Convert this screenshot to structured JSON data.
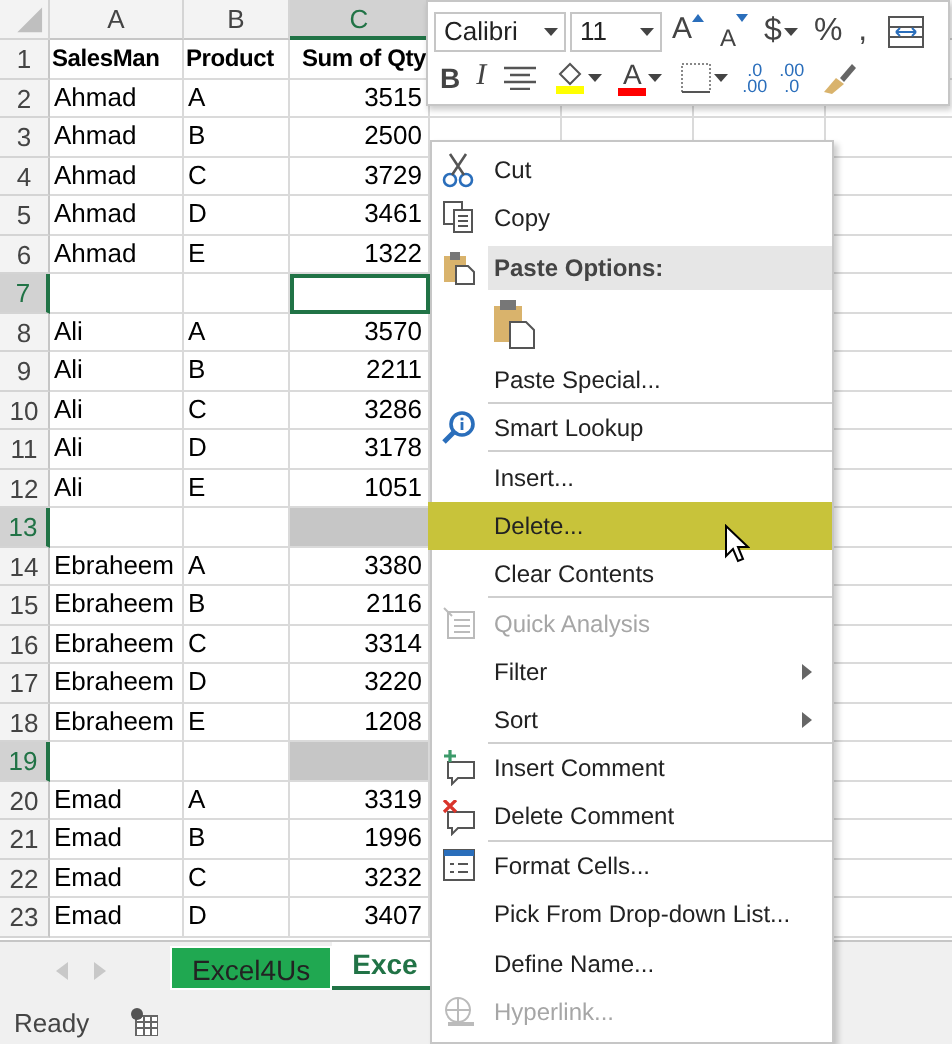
{
  "sheet": {
    "columns": [
      {
        "label": "A",
        "selected": false
      },
      {
        "label": "B",
        "selected": false
      },
      {
        "label": "C",
        "selected": true
      }
    ],
    "rows": [
      {
        "number": "1",
        "cells": [
          "SalesMan",
          "Product",
          "Sum of Qty"
        ],
        "bold": true,
        "selected": false,
        "active_cell": false
      },
      {
        "number": "2",
        "cells": [
          "Ahmad",
          "A",
          "3515"
        ],
        "bold": false,
        "selected": false,
        "active_cell": false
      },
      {
        "number": "3",
        "cells": [
          "Ahmad",
          "B",
          "2500"
        ],
        "bold": false,
        "selected": false,
        "active_cell": false
      },
      {
        "number": "4",
        "cells": [
          "Ahmad",
          "C",
          "3729"
        ],
        "bold": false,
        "selected": false,
        "active_cell": false
      },
      {
        "number": "5",
        "cells": [
          "Ahmad",
          "D",
          "3461"
        ],
        "bold": false,
        "selected": false,
        "active_cell": false
      },
      {
        "number": "6",
        "cells": [
          "Ahmad",
          "E",
          "1322"
        ],
        "bold": false,
        "selected": false,
        "active_cell": false
      },
      {
        "number": "7",
        "cells": [],
        "bold": false,
        "selected": true,
        "active_cell": true
      },
      {
        "number": "8",
        "cells": [
          "Ali",
          "A",
          "3570"
        ],
        "bold": false,
        "selected": false,
        "active_cell": false
      },
      {
        "number": "9",
        "cells": [
          "Ali",
          "B",
          "2211"
        ],
        "bold": false,
        "selected": false,
        "active_cell": false
      },
      {
        "number": "10",
        "cells": [
          "Ali",
          "C",
          "3286"
        ],
        "bold": false,
        "selected": false,
        "active_cell": false
      },
      {
        "number": "11",
        "cells": [
          "Ali",
          "D",
          "3178"
        ],
        "bold": false,
        "selected": false,
        "active_cell": false
      },
      {
        "number": "12",
        "cells": [
          "Ali",
          "E",
          "1051"
        ],
        "bold": false,
        "selected": false,
        "active_cell": false
      },
      {
        "number": "13",
        "cells": [],
        "bold": false,
        "selected": true,
        "active_cell": false
      },
      {
        "number": "14",
        "cells": [
          "Ebraheem",
          "A",
          "3380"
        ],
        "bold": false,
        "selected": false,
        "active_cell": false
      },
      {
        "number": "15",
        "cells": [
          "Ebraheem",
          "B",
          "2116"
        ],
        "bold": false,
        "selected": false,
        "active_cell": false
      },
      {
        "number": "16",
        "cells": [
          "Ebraheem",
          "C",
          "3314"
        ],
        "bold": false,
        "selected": false,
        "active_cell": false
      },
      {
        "number": "17",
        "cells": [
          "Ebraheem",
          "D",
          "3220"
        ],
        "bold": false,
        "selected": false,
        "active_cell": false
      },
      {
        "number": "18",
        "cells": [
          "Ebraheem",
          "E",
          "1208"
        ],
        "bold": false,
        "selected": false,
        "active_cell": false
      },
      {
        "number": "19",
        "cells": [],
        "bold": false,
        "selected": true,
        "active_cell": false
      },
      {
        "number": "20",
        "cells": [
          "Emad",
          "A",
          "3319"
        ],
        "bold": false,
        "selected": false,
        "active_cell": false
      },
      {
        "number": "21",
        "cells": [
          "Emad",
          "B",
          "1996"
        ],
        "bold": false,
        "selected": false,
        "active_cell": false
      },
      {
        "number": "22",
        "cells": [
          "Emad",
          "C",
          "3232"
        ],
        "bold": false,
        "selected": false,
        "active_cell": false
      },
      {
        "number": "23",
        "cells": [
          "Emad",
          "D",
          "3407"
        ],
        "bold": false,
        "selected": false,
        "active_cell": false
      }
    ]
  },
  "mini_toolbar": {
    "font_name": "Calibri",
    "font_size": "11",
    "buttons": [
      {
        "kind": "grow-font",
        "label": "A"
      },
      {
        "kind": "shrink-font",
        "label": "A"
      },
      {
        "kind": "currency",
        "label": "$"
      },
      {
        "kind": "percent",
        "label": "%"
      },
      {
        "kind": "comma",
        "label": ","
      },
      {
        "kind": "wrap"
      },
      {
        "kind": "bold",
        "label": "B"
      },
      {
        "kind": "italic",
        "label": "I"
      },
      {
        "kind": "align"
      },
      {
        "kind": "fill",
        "color": "#ffff00"
      },
      {
        "kind": "font-color",
        "label": "A",
        "color": "#ff0000"
      },
      {
        "kind": "borders"
      },
      {
        "kind": "increase-decimal",
        "top": ".0",
        "bottom": ".00"
      },
      {
        "kind": "decrease-decimal",
        "top": ".00",
        "bottom": ".0"
      },
      {
        "kind": "painter"
      }
    ]
  },
  "context_menu": {
    "items": [
      {
        "kind": "item",
        "label": "Cut",
        "disabled": false,
        "selected": false,
        "submenu": false,
        "divider_after": false
      },
      {
        "kind": "item",
        "label": "Copy",
        "disabled": false,
        "selected": false,
        "submenu": false,
        "divider_after": false
      },
      {
        "kind": "heading",
        "label": "Paste Options:"
      },
      {
        "kind": "paste-options"
      },
      {
        "kind": "item",
        "label": "Paste Special...",
        "disabled": false,
        "selected": false,
        "submenu": false,
        "divider_after": true
      },
      {
        "kind": "item",
        "label": "Smart Lookup",
        "disabled": false,
        "selected": false,
        "submenu": false,
        "divider_after": true
      },
      {
        "kind": "item",
        "label": "Insert...",
        "disabled": false,
        "selected": false,
        "submenu": false,
        "divider_after": false
      },
      {
        "kind": "item",
        "label": "Delete...",
        "disabled": false,
        "selected": true,
        "submenu": false,
        "divider_after": false
      },
      {
        "kind": "item",
        "label": "Clear Contents",
        "disabled": false,
        "selected": false,
        "submenu": false,
        "divider_after": true
      },
      {
        "kind": "item",
        "label": "Quick Analysis",
        "disabled": true,
        "selected": false,
        "submenu": false,
        "divider_after": false
      },
      {
        "kind": "item",
        "label": "Filter",
        "disabled": false,
        "selected": false,
        "submenu": true,
        "divider_after": false
      },
      {
        "kind": "item",
        "label": "Sort",
        "disabled": false,
        "selected": false,
        "submenu": true,
        "divider_after": true
      },
      {
        "kind": "item",
        "label": "Insert Comment",
        "disabled": false,
        "selected": false,
        "submenu": false,
        "divider_after": false
      },
      {
        "kind": "item",
        "label": "Delete Comment",
        "disabled": false,
        "selected": false,
        "submenu": false,
        "divider_after": true
      },
      {
        "kind": "item",
        "label": "Format Cells...",
        "disabled": false,
        "selected": false,
        "submenu": false,
        "divider_after": false
      },
      {
        "kind": "item",
        "label": "Pick From Drop-down List...",
        "disabled": false,
        "selected": false,
        "submenu": false,
        "divider_after": false
      },
      {
        "kind": "item",
        "label": "Define Name...",
        "disabled": false,
        "selected": false,
        "submenu": false,
        "divider_after": false
      },
      {
        "kind": "item",
        "label": "Hyperlink...",
        "disabled": true,
        "selected": false,
        "submenu": false,
        "divider_after": false
      }
    ]
  },
  "sheet_tabs": [
    {
      "label": "Excel4Us",
      "selected": false
    },
    {
      "label": "Exce",
      "selected": true
    }
  ],
  "status_bar": {
    "text": "Ready"
  }
}
